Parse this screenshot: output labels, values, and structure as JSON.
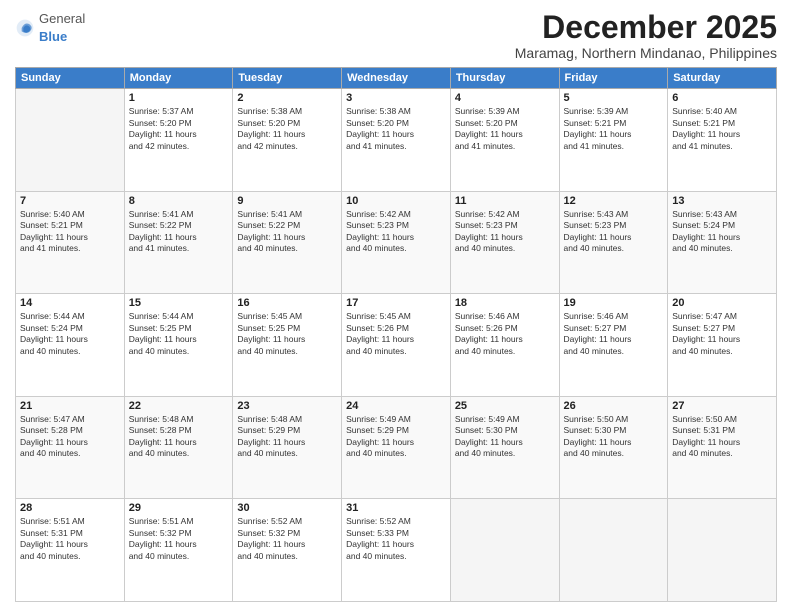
{
  "logo": {
    "general": "General",
    "blue": "Blue"
  },
  "header": {
    "month": "December 2025",
    "location": "Maramag, Northern Mindanao, Philippines"
  },
  "days_of_week": [
    "Sunday",
    "Monday",
    "Tuesday",
    "Wednesday",
    "Thursday",
    "Friday",
    "Saturday"
  ],
  "weeks": [
    [
      {
        "day": "",
        "info": ""
      },
      {
        "day": "1",
        "info": "Sunrise: 5:37 AM\nSunset: 5:20 PM\nDaylight: 11 hours\nand 42 minutes."
      },
      {
        "day": "2",
        "info": "Sunrise: 5:38 AM\nSunset: 5:20 PM\nDaylight: 11 hours\nand 42 minutes."
      },
      {
        "day": "3",
        "info": "Sunrise: 5:38 AM\nSunset: 5:20 PM\nDaylight: 11 hours\nand 41 minutes."
      },
      {
        "day": "4",
        "info": "Sunrise: 5:39 AM\nSunset: 5:20 PM\nDaylight: 11 hours\nand 41 minutes."
      },
      {
        "day": "5",
        "info": "Sunrise: 5:39 AM\nSunset: 5:21 PM\nDaylight: 11 hours\nand 41 minutes."
      },
      {
        "day": "6",
        "info": "Sunrise: 5:40 AM\nSunset: 5:21 PM\nDaylight: 11 hours\nand 41 minutes."
      }
    ],
    [
      {
        "day": "7",
        "info": "Sunrise: 5:40 AM\nSunset: 5:21 PM\nDaylight: 11 hours\nand 41 minutes."
      },
      {
        "day": "8",
        "info": "Sunrise: 5:41 AM\nSunset: 5:22 PM\nDaylight: 11 hours\nand 41 minutes."
      },
      {
        "day": "9",
        "info": "Sunrise: 5:41 AM\nSunset: 5:22 PM\nDaylight: 11 hours\nand 40 minutes."
      },
      {
        "day": "10",
        "info": "Sunrise: 5:42 AM\nSunset: 5:23 PM\nDaylight: 11 hours\nand 40 minutes."
      },
      {
        "day": "11",
        "info": "Sunrise: 5:42 AM\nSunset: 5:23 PM\nDaylight: 11 hours\nand 40 minutes."
      },
      {
        "day": "12",
        "info": "Sunrise: 5:43 AM\nSunset: 5:23 PM\nDaylight: 11 hours\nand 40 minutes."
      },
      {
        "day": "13",
        "info": "Sunrise: 5:43 AM\nSunset: 5:24 PM\nDaylight: 11 hours\nand 40 minutes."
      }
    ],
    [
      {
        "day": "14",
        "info": "Sunrise: 5:44 AM\nSunset: 5:24 PM\nDaylight: 11 hours\nand 40 minutes."
      },
      {
        "day": "15",
        "info": "Sunrise: 5:44 AM\nSunset: 5:25 PM\nDaylight: 11 hours\nand 40 minutes."
      },
      {
        "day": "16",
        "info": "Sunrise: 5:45 AM\nSunset: 5:25 PM\nDaylight: 11 hours\nand 40 minutes."
      },
      {
        "day": "17",
        "info": "Sunrise: 5:45 AM\nSunset: 5:26 PM\nDaylight: 11 hours\nand 40 minutes."
      },
      {
        "day": "18",
        "info": "Sunrise: 5:46 AM\nSunset: 5:26 PM\nDaylight: 11 hours\nand 40 minutes."
      },
      {
        "day": "19",
        "info": "Sunrise: 5:46 AM\nSunset: 5:27 PM\nDaylight: 11 hours\nand 40 minutes."
      },
      {
        "day": "20",
        "info": "Sunrise: 5:47 AM\nSunset: 5:27 PM\nDaylight: 11 hours\nand 40 minutes."
      }
    ],
    [
      {
        "day": "21",
        "info": "Sunrise: 5:47 AM\nSunset: 5:28 PM\nDaylight: 11 hours\nand 40 minutes."
      },
      {
        "day": "22",
        "info": "Sunrise: 5:48 AM\nSunset: 5:28 PM\nDaylight: 11 hours\nand 40 minutes."
      },
      {
        "day": "23",
        "info": "Sunrise: 5:48 AM\nSunset: 5:29 PM\nDaylight: 11 hours\nand 40 minutes."
      },
      {
        "day": "24",
        "info": "Sunrise: 5:49 AM\nSunset: 5:29 PM\nDaylight: 11 hours\nand 40 minutes."
      },
      {
        "day": "25",
        "info": "Sunrise: 5:49 AM\nSunset: 5:30 PM\nDaylight: 11 hours\nand 40 minutes."
      },
      {
        "day": "26",
        "info": "Sunrise: 5:50 AM\nSunset: 5:30 PM\nDaylight: 11 hours\nand 40 minutes."
      },
      {
        "day": "27",
        "info": "Sunrise: 5:50 AM\nSunset: 5:31 PM\nDaylight: 11 hours\nand 40 minutes."
      }
    ],
    [
      {
        "day": "28",
        "info": "Sunrise: 5:51 AM\nSunset: 5:31 PM\nDaylight: 11 hours\nand 40 minutes."
      },
      {
        "day": "29",
        "info": "Sunrise: 5:51 AM\nSunset: 5:32 PM\nDaylight: 11 hours\nand 40 minutes."
      },
      {
        "day": "30",
        "info": "Sunrise: 5:52 AM\nSunset: 5:32 PM\nDaylight: 11 hours\nand 40 minutes."
      },
      {
        "day": "31",
        "info": "Sunrise: 5:52 AM\nSunset: 5:33 PM\nDaylight: 11 hours\nand 40 minutes."
      },
      {
        "day": "",
        "info": ""
      },
      {
        "day": "",
        "info": ""
      },
      {
        "day": "",
        "info": ""
      }
    ]
  ]
}
